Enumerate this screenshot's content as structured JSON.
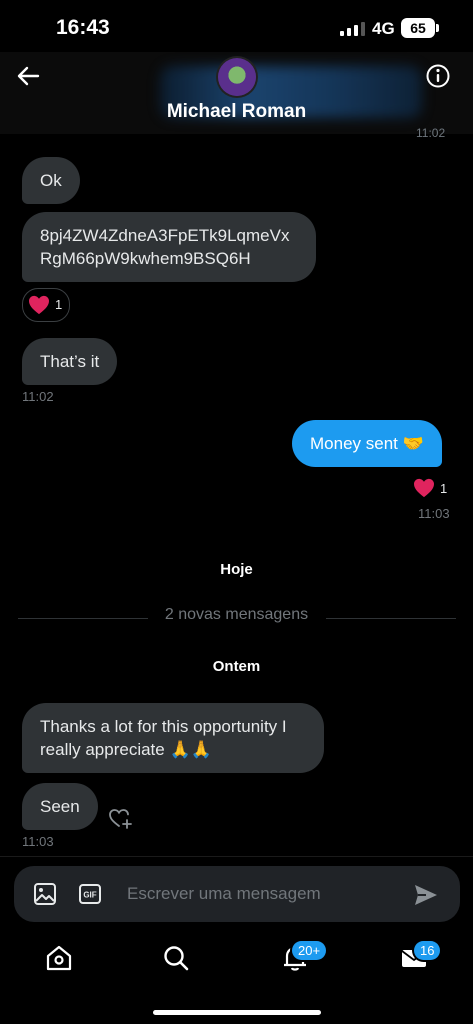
{
  "status_bar": {
    "time": "16:43",
    "network": "4G",
    "battery": "65"
  },
  "header": {
    "contact_name": "Michael Roman",
    "clipped_time": "11:02"
  },
  "messages": {
    "ok": "Ok",
    "address_line1": "8pj4ZW4ZdneA3FpETk9LqmeVx",
    "address_line2": "RgM66pW9kwhem9BSQ6H",
    "address_reaction_count": "1",
    "thats_it": "That’s it",
    "thats_it_time": "11:02",
    "money_sent": "Money sent 🤝",
    "money_sent_reaction_count": "1",
    "money_sent_time": "11:03",
    "day_label_today": "Hoje",
    "new_messages_divider": "2 novas mensagens",
    "day_label_yesterday": "Ontem",
    "thanks_line1": "Thanks a lot for this opportunity I",
    "thanks_line2": "really appreciate 🙏🙏",
    "seen": "Seen",
    "seen_time": "11:03"
  },
  "composer": {
    "placeholder": "Escrever uma mensagem"
  },
  "bottom_nav": {
    "notifications_badge": "20+",
    "messages_badge": "16"
  },
  "colors": {
    "accent": "#1d9bf0",
    "bubble_incoming": "#2f3336",
    "heart": "#f91880"
  },
  "icons": [
    "back-arrow-icon",
    "info-icon",
    "heart-icon",
    "add-reaction-icon",
    "image-icon",
    "gif-icon",
    "send-icon",
    "home-icon",
    "search-icon",
    "bell-icon",
    "mail-icon"
  ]
}
